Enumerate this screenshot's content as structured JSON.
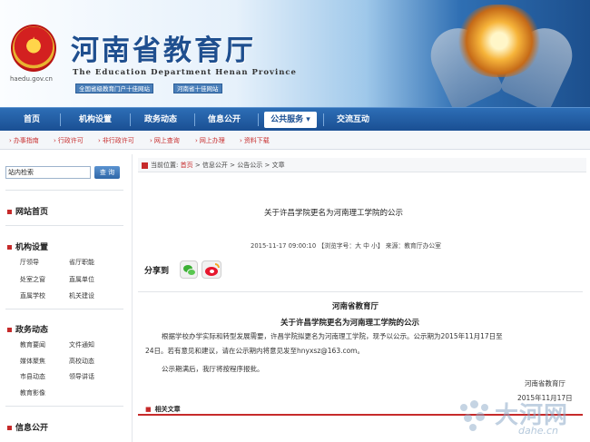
{
  "header": {
    "url": "haedu.gov.cn",
    "title": "河南省教育厅",
    "subtitle": "The Education Department Henan Province",
    "award_1": "全国省级教育门户十佳网站",
    "award_2": "河南省十佳网站"
  },
  "nav": {
    "items": [
      "首页",
      "机构设置",
      "政务动态",
      "信息公开",
      "公共服务",
      "交流互动"
    ],
    "active": "公共服务"
  },
  "subnav": {
    "items": [
      "办事指南",
      "行政许可",
      "非行政许可",
      "网上查询",
      "网上办理",
      "资料下载"
    ]
  },
  "sidebar": {
    "search_value": "站内检索",
    "search_button": "查 询",
    "home": "网站首页",
    "sections": [
      {
        "title": "机构设置",
        "links": [
          "厅领导",
          "省厅职能",
          "处室之窗",
          "直属单位",
          "直属学校",
          "机关建设"
        ]
      },
      {
        "title": "政务动态",
        "links": [
          "教育要闻",
          "文件通知",
          "媒体聚焦",
          "高校动态",
          "市县动态",
          "领导讲话",
          "教育影像"
        ]
      },
      {
        "title": "信息公开",
        "links": []
      }
    ]
  },
  "breadcrumb": {
    "prefix": "当前位置:",
    "items": [
      "首页",
      "信息公开",
      "公告公示",
      "文章"
    ]
  },
  "article": {
    "title": "关于许昌学院更名为河南理工学院的公示",
    "meta": "2015-11-17 09:00:10 【浏览字号：大 中 小】 来源：教育厅办公室",
    "share_label": "分享到",
    "org": "河南省教育厅",
    "heading": "关于许昌学院更名为河南理工学院的公示",
    "paragraph_1a": "根据学校办学实际和转型发展需要，许昌学院拟更名为河南理工学院，现予以公示。公示期为2015年11月17日至",
    "paragraph_1b": "24日。若有意见和建议，请在公示期内将意见发至hnyxsz@163.com。",
    "paragraph_2": "公示期满后，我厅将按程序报批。",
    "sign_org": "河南省教育厅",
    "sign_date": "2015年11月17日",
    "related": "相关文章"
  },
  "watermark": {
    "cn": "大河网",
    "en": "dahe.cn"
  },
  "colors": {
    "nav_blue": "#1a4f93",
    "accent_red": "#c62a2a"
  }
}
